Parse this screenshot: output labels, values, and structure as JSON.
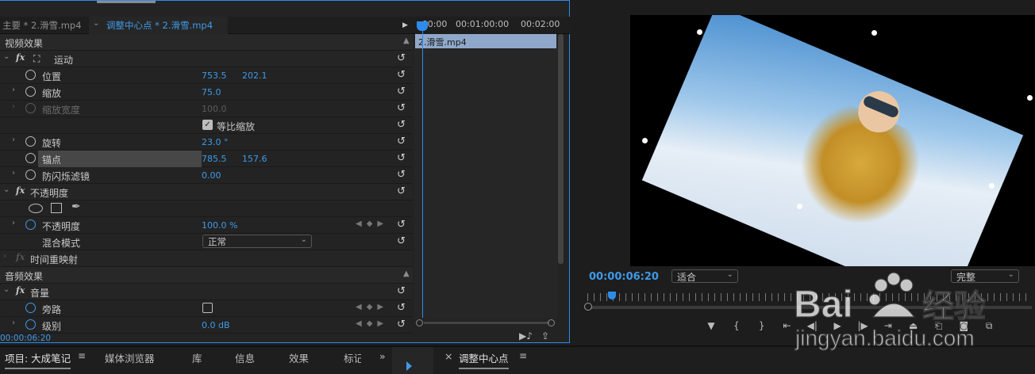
{
  "effect_controls": {
    "tab_master": "主要 * 2.滑雪.mp4",
    "tab_clip": "调整中心点 * 2.滑雪.mp4",
    "ruler_labels": [
      ":00:00",
      "00:01:00:00",
      "00:02:00"
    ],
    "clip_name": "2.滑雪.mp4",
    "rows": {
      "video_effects": "视频效果",
      "motion": "运动",
      "position_label": "位置",
      "position_x": "753.5",
      "position_y": "202.1",
      "scale_label": "缩放",
      "scale_value": "75.0",
      "scale_width_label": "缩放宽度",
      "scale_width_value": "100.0",
      "uniform_scale_label": "等比缩放",
      "rotation_label": "旋转",
      "rotation_value": "23.0 °",
      "anchor_label": "锚点",
      "anchor_x": "785.5",
      "anchor_y": "157.6",
      "antiflicker_label": "防闪烁滤镜",
      "antiflicker_value": "0.00",
      "opacity_group": "不透明度",
      "opacity_label": "不透明度",
      "opacity_value": "100.0 %",
      "blend_label": "混合模式",
      "blend_value": "正常",
      "time_remap": "时间重映射",
      "audio_effects": "音频效果",
      "volume": "音量",
      "bypass_label": "旁路",
      "level_label": "级别",
      "level_value": "0.0 dB"
    },
    "timecode": "00:00:06:20"
  },
  "program_monitor": {
    "timecode": "00:00:06:20",
    "fit_label": "适合",
    "quality_label": "完整"
  },
  "bottom_panel": {
    "project_tab": "项目: 大成笔记",
    "media_browser": "媒体浏览器",
    "library": "库",
    "info": "信息",
    "effects": "效果",
    "markers": "标记",
    "more": "»",
    "sequence_tab": "调整中心点"
  },
  "watermark": {
    "brand": "Bai",
    "brand_cn": "经验",
    "url": "jingyan.baidu.com"
  },
  "colors": {
    "accent": "#2d8ceb",
    "value_blue": "#3e9ae8",
    "clip_bar": "#8fa8c9"
  }
}
